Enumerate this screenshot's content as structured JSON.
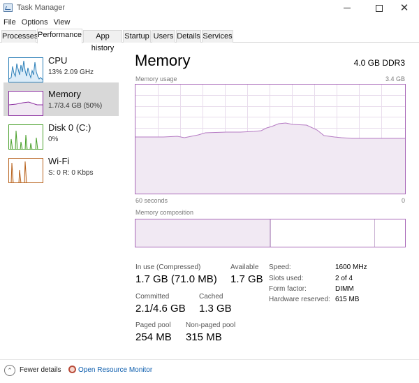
{
  "window": {
    "title": "Task Manager",
    "controls": {
      "minimize": "minimize-icon",
      "maximize": "maximize-icon",
      "close": "close-icon"
    }
  },
  "menu": [
    "File",
    "Options",
    "View"
  ],
  "tabs": [
    {
      "label": "Processes",
      "active": false
    },
    {
      "label": "Performance",
      "active": true
    },
    {
      "label": "App history",
      "active": false
    },
    {
      "label": "Startup",
      "active": false
    },
    {
      "label": "Users",
      "active": false
    },
    {
      "label": "Details",
      "active": false
    },
    {
      "label": "Services",
      "active": false
    }
  ],
  "sidebar": {
    "items": [
      {
        "title": "CPU",
        "sub": "13%  2.09 GHz",
        "color": "#2c7fb8",
        "fill": "#dcecf8",
        "active": false
      },
      {
        "title": "Memory",
        "sub": "1.7/3.4 GB (50%)",
        "color": "#8b2fa0",
        "fill": "#f1e9f3",
        "active": true
      },
      {
        "title": "Disk 0 (C:)",
        "sub": "0%",
        "color": "#4aa02c",
        "fill": "#e6f3dd",
        "active": false
      },
      {
        "title": "Wi-Fi",
        "sub": "S: 0  R: 0 Kbps",
        "color": "#b8631e",
        "fill": "#f8e8da",
        "active": false
      }
    ]
  },
  "main": {
    "title": "Memory",
    "spec": "4.0 GB DDR3",
    "usage_label": "Memory usage",
    "usage_max": "3.4 GB",
    "time_left": "60 seconds",
    "time_right": "0",
    "composition_label": "Memory composition",
    "graph_color": "#b57ac3",
    "graph_fill": "#f1e9f3",
    "usage_level": 0.5
  },
  "stats": {
    "in_use_label": "In use (Compressed)",
    "in_use_value": "1.7 GB (71.0 MB)",
    "available_label": "Available",
    "available_value": "1.7 GB",
    "committed_label": "Committed",
    "committed_value": "2.1/4.6 GB",
    "cached_label": "Cached",
    "cached_value": "1.3 GB",
    "paged_label": "Paged pool",
    "paged_value": "254 MB",
    "nonpaged_label": "Non-paged pool",
    "nonpaged_value": "315 MB"
  },
  "details": [
    {
      "key": "Speed:",
      "value": "1600 MHz"
    },
    {
      "key": "Slots used:",
      "value": "2 of 4"
    },
    {
      "key": "Form factor:",
      "value": "DIMM"
    },
    {
      "key": "Hardware reserved:",
      "value": "615 MB"
    }
  ],
  "footer": {
    "fewer_details": "Fewer details",
    "resource_monitor": "Open Resource Monitor"
  }
}
